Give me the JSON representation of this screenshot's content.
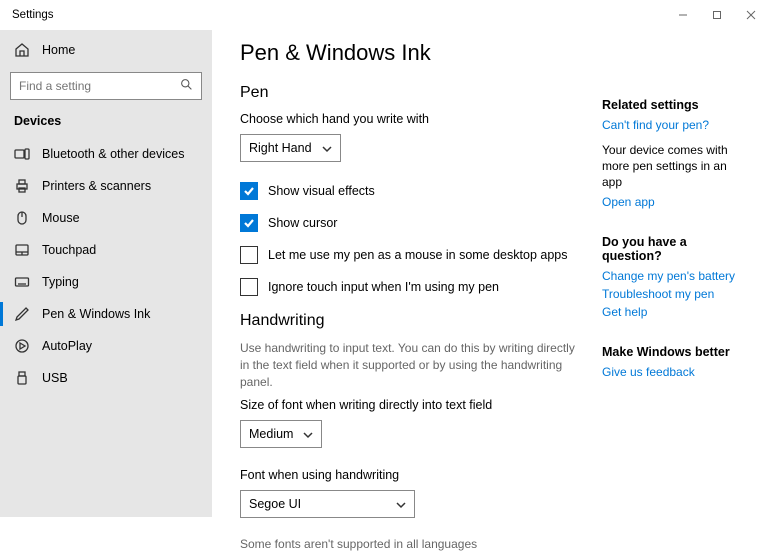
{
  "window": {
    "title": "Settings"
  },
  "sidebar": {
    "home": "Home",
    "search_placeholder": "Find a setting",
    "category": "Devices",
    "items": [
      {
        "label": "Bluetooth & other devices"
      },
      {
        "label": "Printers & scanners"
      },
      {
        "label": "Mouse"
      },
      {
        "label": "Touchpad"
      },
      {
        "label": "Typing"
      },
      {
        "label": "Pen & Windows Ink"
      },
      {
        "label": "AutoPlay"
      },
      {
        "label": "USB"
      }
    ]
  },
  "page": {
    "title": "Pen & Windows Ink",
    "pen": {
      "heading": "Pen",
      "hand_label": "Choose which hand you write with",
      "hand_value": "Right Hand",
      "show_visual_effects": "Show visual effects",
      "show_cursor": "Show cursor",
      "pen_as_mouse": "Let me use my pen as a mouse in some desktop apps",
      "ignore_touch": "Ignore touch input when I'm using my pen"
    },
    "handwriting": {
      "heading": "Handwriting",
      "desc": "Use handwriting to input text. You can do this by writing directly in the text field when it supported or by using the handwriting panel.",
      "font_size_label": "Size of font when writing directly into text field",
      "font_size_value": "Medium",
      "font_label": "Font when using handwriting",
      "font_value": "Segoe UI",
      "font_note": "Some fonts aren't supported in all languages"
    }
  },
  "right": {
    "related_heading": "Related settings",
    "cant_find": "Can't find your pen?",
    "more_settings": "Your device comes with more pen settings in an app",
    "open_app": "Open app",
    "question_heading": "Do you have a question?",
    "change_battery": "Change my pen's battery",
    "troubleshoot": "Troubleshoot my pen",
    "get_help": "Get help",
    "better_heading": "Make Windows better",
    "feedback": "Give us feedback"
  }
}
